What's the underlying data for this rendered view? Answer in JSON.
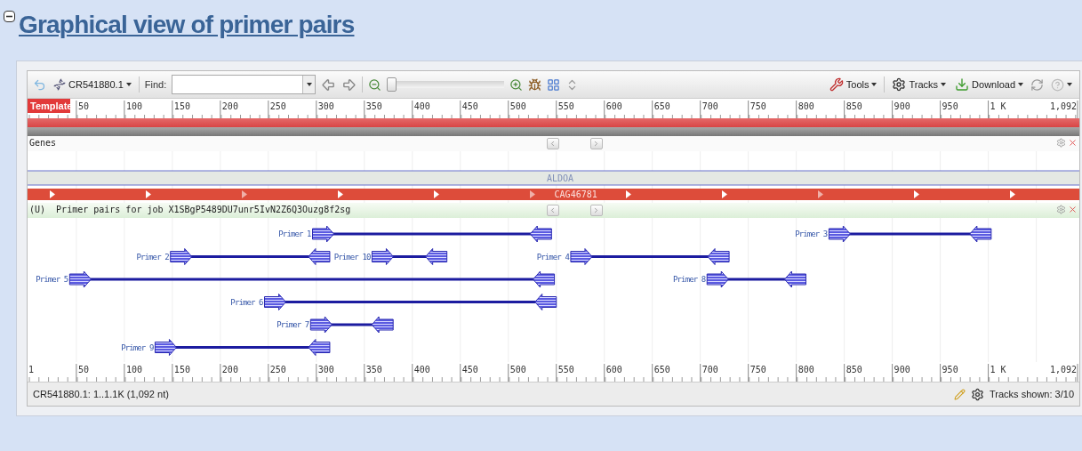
{
  "heading": {
    "title": "Graphical view of primer pairs",
    "expanded": true
  },
  "toolbar": {
    "sequence": "CR541880.1",
    "find_label": "Find:",
    "zoom": {
      "level": 0
    },
    "tools": "Tools",
    "tracks": "Tracks",
    "download": "Download"
  },
  "ruler": {
    "label": "Template",
    "ticks": [
      "50",
      "100",
      "150",
      "200",
      "250",
      "300",
      "350",
      "400",
      "450",
      "500",
      "550",
      "600",
      "650",
      "700",
      "750",
      "800",
      "850",
      "900",
      "950",
      "1 K"
    ],
    "end": "1,092"
  },
  "tracks": [
    {
      "kind": "genes",
      "title": "Genes",
      "gene_label": "ALDOA",
      "feature_label": "CAG46781"
    },
    {
      "kind": "primers",
      "title": "(U)  Primer pairs for job X1SBgP5489DU7unr5IvN2Z6Q3Ouzg8f2sg",
      "primers": [
        {
          "label": "Primer 1"
        },
        {
          "label": "Primer 2"
        },
        {
          "label": "Primer 3"
        },
        {
          "label": "Primer 4"
        },
        {
          "label": "Primer 5"
        },
        {
          "label": "Primer 6"
        },
        {
          "label": "Primer 7"
        },
        {
          "label": "Primer 8"
        },
        {
          "label": "Primer 9"
        },
        {
          "label": "Primer 10"
        }
      ]
    }
  ],
  "bottom_ruler": {
    "start": "1",
    "ticks": [
      "50",
      "100",
      "150",
      "200",
      "250",
      "300",
      "350",
      "400",
      "450",
      "500",
      "550",
      "600",
      "650",
      "700",
      "750",
      "800",
      "850",
      "900",
      "950",
      "1 K"
    ],
    "end": "1,092"
  },
  "status": {
    "location": "CR541880.1: 1..1.1K (1,092 nt)",
    "tracks_shown": "Tracks shown: 3/10"
  }
}
